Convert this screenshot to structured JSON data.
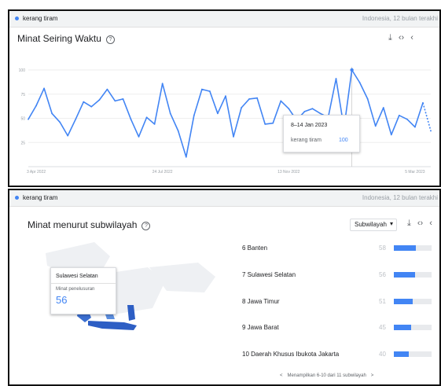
{
  "panel_time": {
    "term": "kerang tiram",
    "geo": "Indonesia, 12 bulan terakhi",
    "title": "Minat Seiring Waktu",
    "help_icon": "help-icon",
    "tools": [
      "download-icon",
      "embed-icon",
      "share-icon"
    ],
    "tooltip": {
      "date": "8–14 Jan 2023",
      "term": "kerang tiram",
      "value": "100"
    }
  },
  "chart_data": {
    "type": "line",
    "title": "Minat Seiring Waktu",
    "xlabel": "",
    "ylabel": "",
    "ylim": [
      0,
      100
    ],
    "yticks": [
      25,
      50,
      75,
      100
    ],
    "xtick_labels": [
      "3 Apr 2022",
      "24 Jul 2022",
      "13 Nov 2022",
      "5 Mar 2023"
    ],
    "grid": true,
    "accent": "#4285f4",
    "series": [
      {
        "name": "kerang tiram",
        "x": [
          "2022-03-27",
          "2022-04-03",
          "2022-04-10",
          "2022-04-17",
          "2022-04-24",
          "2022-05-01",
          "2022-05-08",
          "2022-05-15",
          "2022-05-22",
          "2022-05-29",
          "2022-06-05",
          "2022-06-12",
          "2022-06-19",
          "2022-06-26",
          "2022-07-03",
          "2022-07-10",
          "2022-07-17",
          "2022-07-24",
          "2022-07-31",
          "2022-08-07",
          "2022-08-14",
          "2022-08-21",
          "2022-08-28",
          "2022-09-04",
          "2022-09-11",
          "2022-09-18",
          "2022-09-25",
          "2022-10-02",
          "2022-10-09",
          "2022-10-16",
          "2022-10-23",
          "2022-10-30",
          "2022-11-06",
          "2022-11-13",
          "2022-11-20",
          "2022-11-27",
          "2022-12-04",
          "2022-12-11",
          "2022-12-18",
          "2022-12-25",
          "2023-01-01",
          "2023-01-08",
          "2023-01-15",
          "2023-01-22",
          "2023-01-29",
          "2023-02-05",
          "2023-02-12",
          "2023-02-19",
          "2023-02-26",
          "2023-03-05",
          "2023-03-12",
          "2023-03-19"
        ],
        "values": [
          49,
          63,
          81,
          55,
          46,
          32,
          49,
          67,
          62,
          69,
          80,
          68,
          70,
          49,
          31,
          51,
          44,
          86,
          55,
          37,
          10,
          53,
          80,
          78,
          55,
          73,
          31,
          61,
          70,
          71,
          44,
          45,
          68,
          60,
          48,
          57,
          60,
          55,
          51,
          91,
          40,
          100,
          87,
          70,
          42,
          61,
          33,
          53,
          49,
          41,
          66,
          37
        ],
        "partial_from_index": 50
      }
    ]
  },
  "panel_region": {
    "term": "kerang tiram",
    "geo": "Indonesia, 12 bulan terakhi",
    "title": "Minat menurut subwilayah",
    "help_icon": "help-icon",
    "dropdown": "Subwilayah",
    "tools": [
      "download-icon",
      "embed-icon",
      "share-icon"
    ],
    "map_tooltip": {
      "region": "Sulawesi Selatan",
      "metric": "Minat penelusuran",
      "value": "56"
    },
    "rows": [
      {
        "label": "6  Banten",
        "value": 58
      },
      {
        "label": "7  Sulawesi Selatan",
        "value": 56
      },
      {
        "label": "8  Jawa Timur",
        "value": 51
      },
      {
        "label": "9  Jawa Barat",
        "value": 45
      },
      {
        "label": "10  Daerah Khusus Ibukota Jakarta",
        "value": 40
      }
    ],
    "pager_text": "Menampilkan 6-10 dari 11 subwilayah"
  }
}
